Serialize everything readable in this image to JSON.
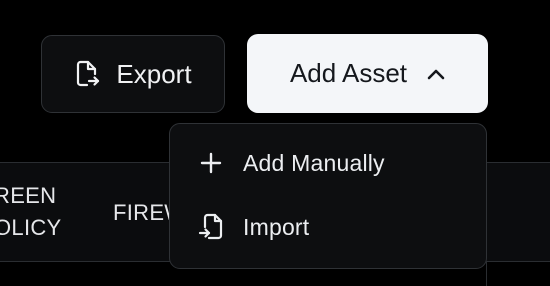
{
  "table": {
    "columns": [
      "SCREEN\nPOLICY",
      "FIREWALL"
    ],
    "visible_fragments": [
      "REEN\nOLICY",
      "FIREW"
    ]
  },
  "toolbar": {
    "export_label": "Export",
    "export_icon": "file-export-icon",
    "add_asset_label": "Add Asset",
    "add_asset_icon": "chevron-up-icon"
  },
  "menu": {
    "items": [
      {
        "label": "Add Manually",
        "icon": "plus-icon"
      },
      {
        "label": "Import",
        "icon": "file-import-icon"
      }
    ]
  },
  "colors": {
    "background": "#000000",
    "panel": "#0d0e10",
    "border": "#2f3236",
    "primary_button_bg": "#f4f6f9",
    "primary_button_text": "#15181d",
    "text": "#eceef1"
  }
}
